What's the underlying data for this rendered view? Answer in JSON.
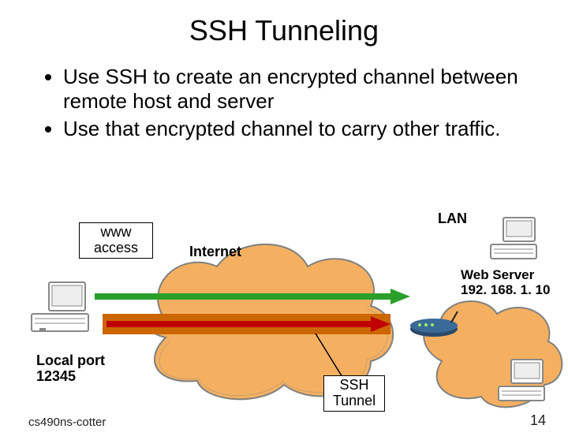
{
  "title": "SSH Tunneling",
  "bullets": [
    "Use SSH to create an encrypted channel between remote host and server",
    "Use that encrypted channel to carry other traffic."
  ],
  "diagram": {
    "www_access": "www\naccess",
    "internet": "Internet",
    "lan": "LAN",
    "web_server": "Web Server\n192. 168. 1. 10",
    "local_port": "Local port\n12345",
    "ssh_tunnel": "SSH\nTunnel"
  },
  "footer": {
    "left": "cs490ns-cotter",
    "page": "14"
  }
}
